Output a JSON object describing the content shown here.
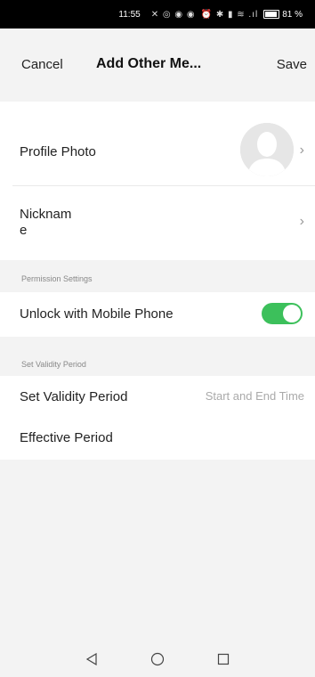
{
  "status_bar": {
    "time": "11:55",
    "left_icons": "✕ ◎ ◉ ◉",
    "right_icons": "⏰ ✱ ▮ ≋ .ıl",
    "battery": "81 %"
  },
  "header": {
    "cancel_label": "Cancel",
    "title": "Add Other Me...",
    "save_label": "Save"
  },
  "profile": {
    "photo_label": "Profile Photo",
    "nickname_label_line1": "Nicknam",
    "nickname_label_line2": "e"
  },
  "permission": {
    "section_header": "Permission Settings",
    "unlock_label": "Unlock with Mobile Phone",
    "unlock_enabled": true
  },
  "validity": {
    "section_header": "Set Validity Period",
    "set_label": "Set Validity Period",
    "set_value": "Start and End Time",
    "effective_label": "Effective Period"
  },
  "colors": {
    "toggle_on": "#3cc05b",
    "background": "#f3f3f3"
  }
}
